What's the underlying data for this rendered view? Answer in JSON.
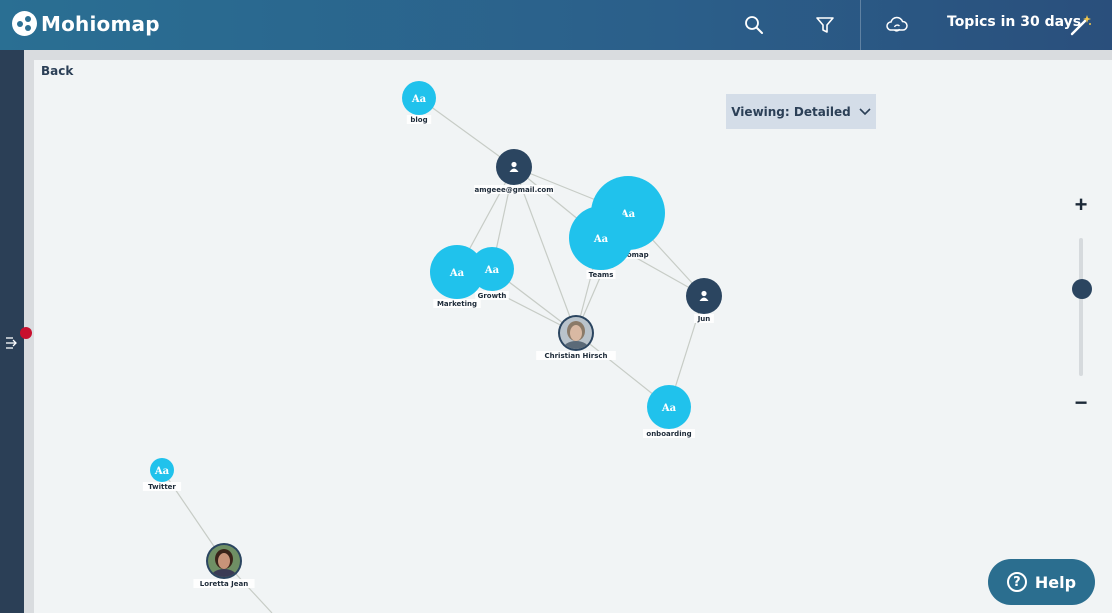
{
  "header": {
    "brand": "Mohiomap",
    "icons": [
      "search-icon",
      "filter-icon",
      "cloud-sync-icon",
      "magic-wand-icon"
    ],
    "topics_label": "Topics in 30 days"
  },
  "canvas": {
    "back_label": "Back",
    "viewing_label": "Viewing: Detailed"
  },
  "zoom": {
    "plus": "+",
    "minus": "−",
    "level": 0.63
  },
  "help": {
    "label": "Help",
    "icon": "?"
  },
  "colors": {
    "topic": "#20c2ec",
    "person": "#2b4560",
    "edge": "#c7ccc6",
    "topbar": "#2a6f93",
    "rail": "#2b3f56",
    "alert": "#c8102e"
  },
  "graph": {
    "nodes": [
      {
        "id": "blog",
        "kind": "topic",
        "icon": "Aa",
        "label": "blog"
      },
      {
        "id": "amgeee",
        "kind": "person",
        "icon": "user-icon",
        "label": "amgeee@gmail.com"
      },
      {
        "id": "mohiomap",
        "kind": "topic",
        "icon": "Aa",
        "label": "mohiomap"
      },
      {
        "id": "teams",
        "kind": "topic",
        "icon": "Aa",
        "label": "Teams"
      },
      {
        "id": "growth",
        "kind": "topic",
        "icon": "Aa",
        "label": "Growth"
      },
      {
        "id": "marketing",
        "kind": "topic",
        "icon": "Aa",
        "label": "Marketing"
      },
      {
        "id": "christian",
        "kind": "person-photo",
        "icon": "avatar",
        "label": "Christian Hirsch"
      },
      {
        "id": "jun",
        "kind": "person",
        "icon": "user-icon",
        "label": "Jun"
      },
      {
        "id": "onboarding",
        "kind": "topic",
        "icon": "Aa",
        "label": "onboarding"
      },
      {
        "id": "twitter",
        "kind": "topic",
        "icon": "Aa",
        "label": "Twitter"
      },
      {
        "id": "loretta",
        "kind": "person-photo",
        "icon": "avatar",
        "label": "Loretta Jean"
      }
    ],
    "edges": [
      [
        "blog",
        "amgeee"
      ],
      [
        "amgeee",
        "mohiomap"
      ],
      [
        "amgeee",
        "teams"
      ],
      [
        "amgeee",
        "growth"
      ],
      [
        "amgeee",
        "marketing"
      ],
      [
        "amgeee",
        "christian"
      ],
      [
        "mohiomap",
        "jun"
      ],
      [
        "teams",
        "jun"
      ],
      [
        "mohiomap",
        "christian"
      ],
      [
        "teams",
        "christian"
      ],
      [
        "growth",
        "christian"
      ],
      [
        "marketing",
        "christian"
      ],
      [
        "christian",
        "onboarding"
      ],
      [
        "jun",
        "onboarding"
      ],
      [
        "twitter",
        "loretta"
      ],
      [
        "loretta",
        "offscreen"
      ]
    ]
  }
}
